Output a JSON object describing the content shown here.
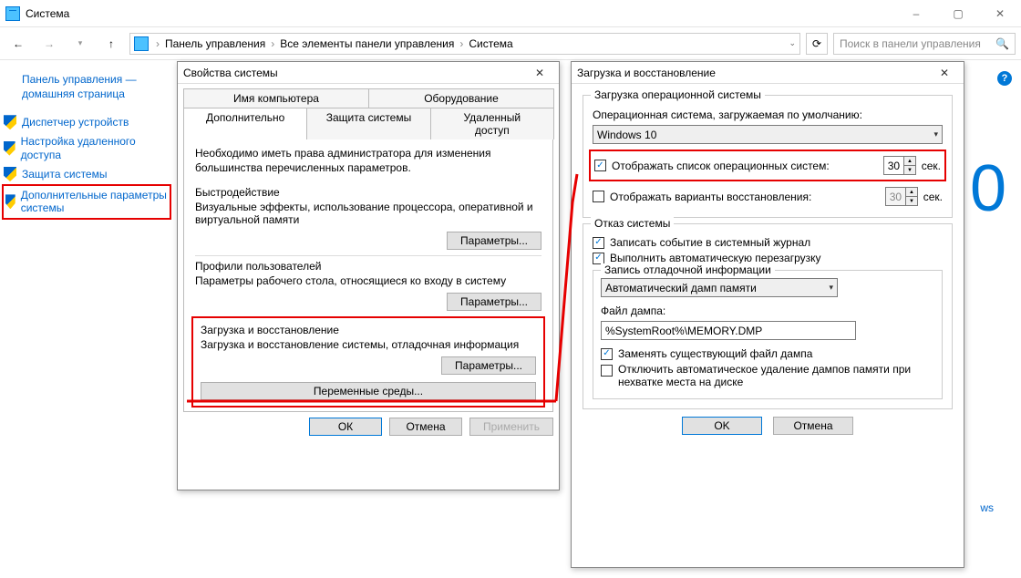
{
  "window": {
    "title": "Система",
    "min": "–",
    "max": "▢",
    "close": "✕"
  },
  "toolbar": {
    "bc_root": "Панель управления",
    "bc_all": "Все элементы панели управления",
    "bc_sys": "Система",
    "search_placeholder": "Поиск в панели управления"
  },
  "sidebar": {
    "home": "Панель управления — домашняя страница",
    "items": [
      "Диспетчер устройств",
      "Настройка удаленного доступа",
      "Защита системы",
      "Дополнительные параметры системы"
    ]
  },
  "right_num": "0",
  "right_link": "ws",
  "sysprops": {
    "title": "Свойства системы",
    "tabs_row1": [
      "Имя компьютера",
      "Оборудование"
    ],
    "tabs_row2": [
      "Дополнительно",
      "Защита системы",
      "Удаленный доступ"
    ],
    "note": "Необходимо иметь права администратора для изменения большинства перечисленных параметров.",
    "perf_title": "Быстродействие",
    "perf_desc": "Визуальные эффекты, использование процессора, оперативной и виртуальной памяти",
    "params_btn": "Параметры...",
    "prof_title": "Профили пользователей",
    "prof_desc": "Параметры рабочего стола, относящиеся ко входу в систему",
    "boot_title": "Загрузка и восстановление",
    "boot_desc": "Загрузка и восстановление системы, отладочная информация",
    "env_btn": "Переменные среды...",
    "ok": "ОК",
    "cancel": "Отмена",
    "apply": "Применить"
  },
  "startup": {
    "title": "Загрузка и восстановление",
    "boot_grp": "Загрузка операционной системы",
    "default_os_label": "Операционная система, загружаемая по умолчанию:",
    "default_os_value": "Windows 10",
    "show_list_chk": "Отображать список операционных систем:",
    "show_list_val": "30",
    "sec": "сек.",
    "show_recov_chk": "Отображать варианты восстановления:",
    "show_recov_val": "30",
    "fail_grp": "Отказ системы",
    "log_chk": "Записать событие в системный журнал",
    "restart_chk": "Выполнить автоматическую перезагрузку",
    "debug_grp": "Запись отладочной информации",
    "dump_type": "Автоматический дамп памяти",
    "dump_file_label": "Файл дампа:",
    "dump_file_value": "%SystemRoot%\\MEMORY.DMP",
    "overwrite_chk": "Заменять существующий файл дампа",
    "noautodel_chk": "Отключить автоматическое удаление дампов памяти при нехватке места на диске",
    "ok": "OK",
    "cancel": "Отмена"
  }
}
